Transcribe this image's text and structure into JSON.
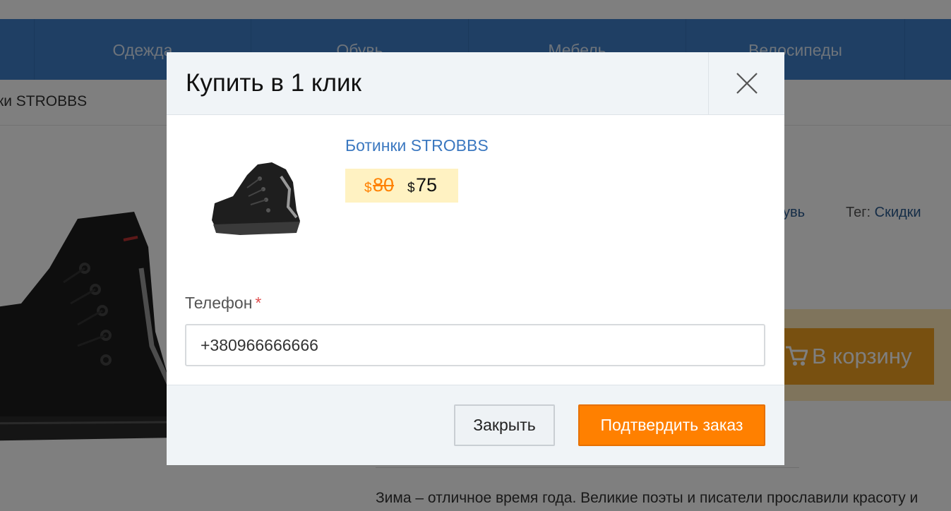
{
  "background": {
    "categories": [
      "Одежда",
      "Обувь",
      "Мебель",
      "Велосипеды"
    ],
    "breadcrumb_tail": "ки STROBBS",
    "meta": {
      "category_link": "бувь",
      "tag_label": "Тег:",
      "tag_value": "Скидки"
    },
    "cart_button_label": "В корзину",
    "description": "Зима – отличное время года. Великие поэты и писатели прославили красоту и"
  },
  "modal": {
    "title": "Купить в 1 клик",
    "close_icon": "close-icon",
    "product": {
      "name": "Ботинки STROBBS",
      "image_icon": "boot-image",
      "currency_symbol": "$",
      "old_price": "80",
      "new_price": "75"
    },
    "phone": {
      "label": "Телефон",
      "required_mark": "*",
      "value": "+380966666666"
    },
    "buttons": {
      "close": "Закрыть",
      "confirm": "Подтвердить заказ"
    }
  },
  "colors": {
    "nav": "#3e7fc9",
    "accent": "#ff8000",
    "link": "#3b78c0",
    "price_bg": "#fff2c2"
  }
}
